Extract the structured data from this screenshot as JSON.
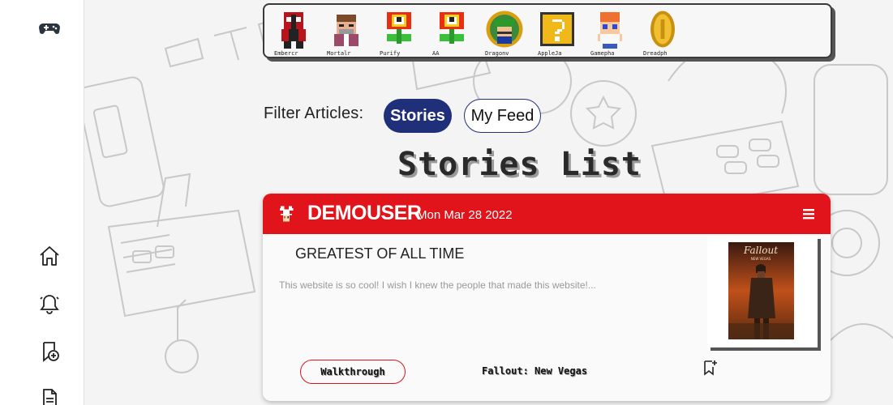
{
  "sidebar": {
    "icons": [
      "gamepad-icon",
      "home-icon",
      "bell-icon",
      "add-bookmark-icon",
      "document-icon"
    ]
  },
  "users": [
    {
      "name": "Embercr",
      "avatar": "deadpool-avatar"
    },
    {
      "name": "Mortalr",
      "avatar": "old-man-avatar"
    },
    {
      "name": "Purify",
      "avatar": "fire-flower-avatar"
    },
    {
      "name": "AA",
      "avatar": "fire-flower-avatar"
    },
    {
      "name": "Dragonv",
      "avatar": "luigi-avatar"
    },
    {
      "name": "AppleJa",
      "avatar": "question-block-avatar"
    },
    {
      "name": "Gamepha",
      "avatar": "boy-avatar"
    },
    {
      "name": "Dreadph",
      "avatar": "coin-avatar"
    }
  ],
  "filter": {
    "label": "Filter Articles:",
    "options": [
      {
        "label": "Stories",
        "active": true
      },
      {
        "label": "My Feed",
        "active": false
      }
    ]
  },
  "list_title": "Stories List",
  "stories": [
    {
      "author": "DEMOUSER",
      "date": "Mon Mar 28 2022",
      "title": "GREATEST OF ALL TIME",
      "excerpt": "This website is so cool! I wish I knew the people that made this website!...",
      "tag": "Walkthrough",
      "game": "Fallout: New Vegas",
      "cover_alt": "Fallout New Vegas cover art"
    }
  ],
  "colors": {
    "header_red": "#e0141a",
    "pill_navy": "#1f2f7a",
    "background": "#f4f4f4"
  }
}
